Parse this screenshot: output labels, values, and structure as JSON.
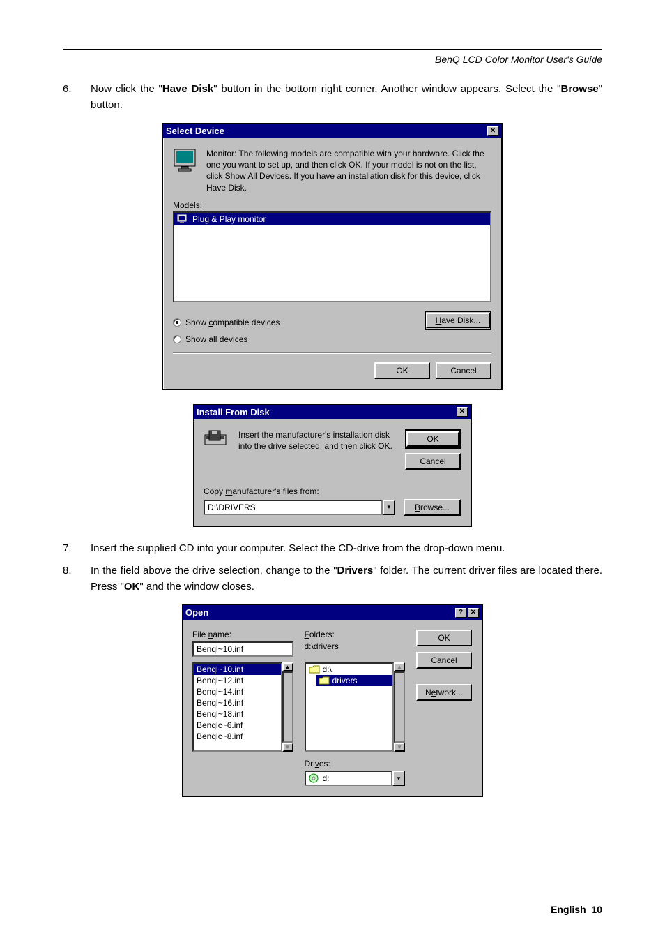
{
  "header": {
    "doc_title": "BenQ LCD Color Monitor User's Guide"
  },
  "steps": {
    "s6": {
      "num": "6.",
      "text_parts": [
        "Now click the \"",
        "Have Disk",
        "\" button in the bottom right corner. Another window appears. Select the \"",
        "Browse",
        "\" button."
      ]
    },
    "s7": {
      "num": "7.",
      "text": "Insert the supplied CD into your computer. Select the CD-drive from the drop-down menu."
    },
    "s8": {
      "num": "8.",
      "text_parts": [
        "In the field above the drive selection, change to the \"",
        "Drivers",
        "\" folder. The current driver files are located there. Press \"",
        "OK",
        "\" and the window closes."
      ]
    }
  },
  "dlg_select": {
    "title": "Select Device",
    "intro": "Monitor: The following models are compatible with your hardware. Click the one you want to set up, and then click OK. If your model is not on the list, click Show All Devices. If you have an installation disk for this device, click Have Disk.",
    "models_label_pre": "Mode",
    "models_label_u": "l",
    "models_label_post": "s:",
    "item": "Plug & Play monitor",
    "radio_compat_pre": "Show ",
    "radio_compat_u": "c",
    "radio_compat_post": "ompatible devices",
    "radio_all_pre": "Show ",
    "radio_all_u": "a",
    "radio_all_post": "ll devices",
    "have_disk_u": "H",
    "have_disk_post": "ave Disk...",
    "ok": "OK",
    "cancel": "Cancel"
  },
  "dlg_install": {
    "title": "Install From Disk",
    "intro": "Insert the manufacturer's installation disk into the drive selected, and then click OK.",
    "ok": "OK",
    "cancel": "Cancel",
    "copy_label_pre": "Copy ",
    "copy_label_u": "m",
    "copy_label_post": "anufacturer's files from:",
    "path": "D:\\DRIVERS",
    "browse_u": "B",
    "browse_post": "rowse..."
  },
  "dlg_open": {
    "title": "Open",
    "file_name_label_pre": "File ",
    "file_name_label_u": "n",
    "file_name_label_post": "ame:",
    "file_name_value": "Benql~10.inf",
    "folders_label_u": "F",
    "folders_label_post": "olders:",
    "folders_path": "d:\\drivers",
    "file_list": [
      "Benql~10.inf",
      "Benql~12.inf",
      "Benql~14.inf",
      "Benql~16.inf",
      "Benql~18.inf",
      "Benqlc~6.inf",
      "Benqlc~8.inf"
    ],
    "folder_list": [
      "d:\\",
      "drivers"
    ],
    "drives_label_pre": "Dri",
    "drives_label_u": "v",
    "drives_label_post": "es:",
    "drive_value": "d:",
    "ok": "OK",
    "cancel": "Cancel",
    "network_pre": "N",
    "network_u": "e",
    "network_post": "twork..."
  },
  "footer": {
    "lang": "English",
    "page": "10"
  }
}
